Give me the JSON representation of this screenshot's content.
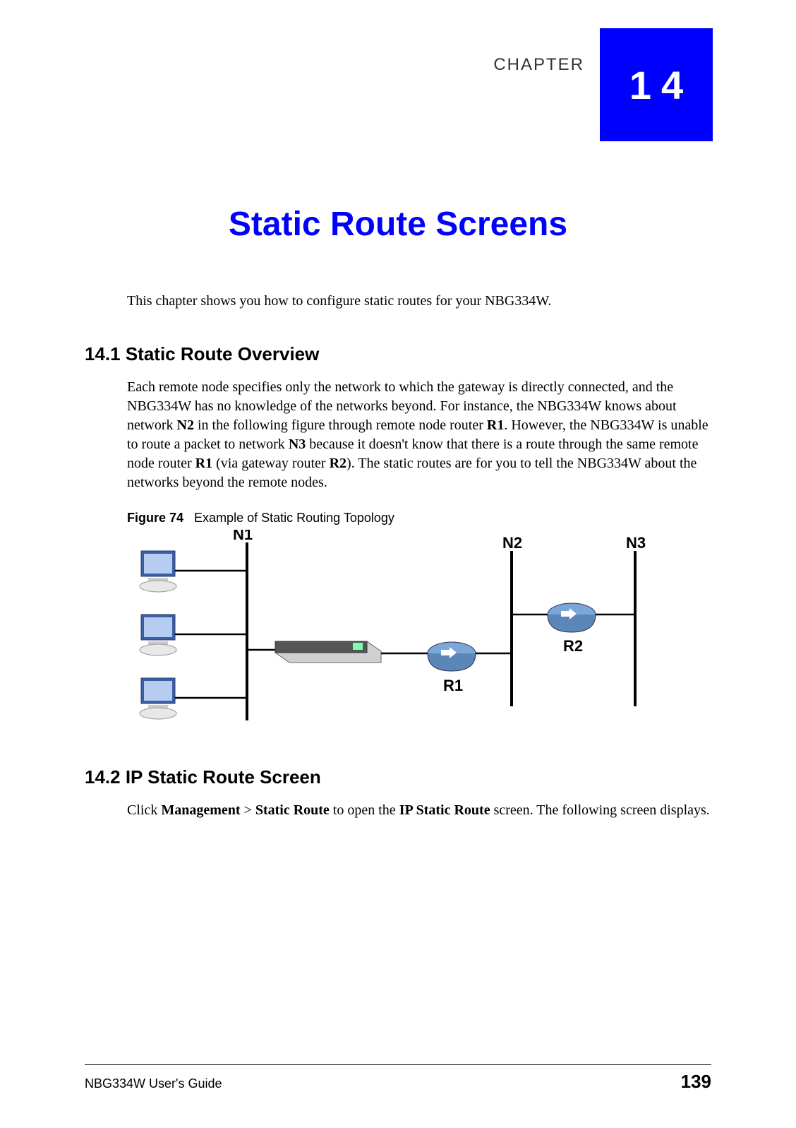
{
  "chapter": {
    "number": "14",
    "label": "CHAPTER",
    "title": "Static Route Screens"
  },
  "intro": "This chapter shows you how to configure static routes for your NBG334W.",
  "section1": {
    "heading": "14.1  Static Route Overview",
    "p_parts": [
      "Each remote node specifies only the network to which the gateway is directly connected, and the NBG334W has no knowledge of the networks beyond. For instance, the NBG334W knows about network ",
      "N2",
      " in the following figure through remote node router ",
      "R1",
      ". However, the NBG334W is unable to route a packet to network ",
      "N3",
      " because it doesn't know that there is a route through the same remote node router ",
      "R1",
      " (via gateway router ",
      "R2",
      "). The static routes are for you to tell the NBG334W about the networks beyond the remote nodes."
    ]
  },
  "figure": {
    "label": "Figure 74",
    "caption": "Example of Static Routing Topology",
    "labels": {
      "n1": "N1",
      "n2": "N2",
      "n3": "N3",
      "r1": "R1",
      "r2": "R2"
    }
  },
  "section2": {
    "heading": "14.2  IP Static Route Screen",
    "p_parts": [
      "Click ",
      "Management",
      " > ",
      "Static Route",
      " to open the ",
      "IP Static Route",
      " screen. The following screen displays."
    ]
  },
  "footer": {
    "left": "NBG334W User's Guide",
    "right": "139"
  }
}
